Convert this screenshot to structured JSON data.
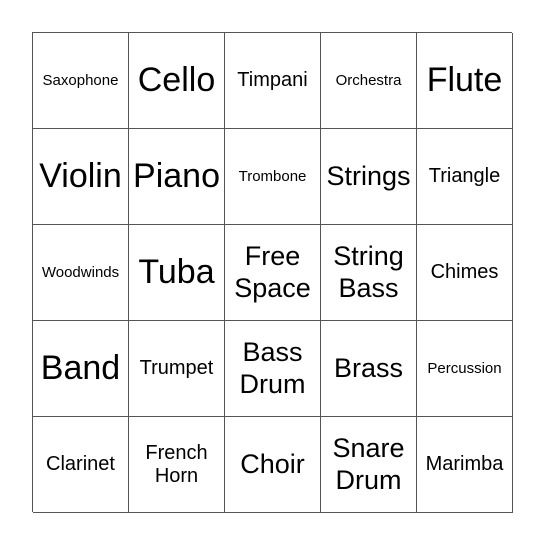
{
  "card": {
    "cells": [
      {
        "text": "Saxophone",
        "size": "s1"
      },
      {
        "text": "Cello",
        "size": "s4"
      },
      {
        "text": "Timpani",
        "size": "s2"
      },
      {
        "text": "Orchestra",
        "size": "s1"
      },
      {
        "text": "Flute",
        "size": "s4"
      },
      {
        "text": "Violin",
        "size": "s4"
      },
      {
        "text": "Piano",
        "size": "s4"
      },
      {
        "text": "Trombone",
        "size": "s1"
      },
      {
        "text": "Strings",
        "size": "s3"
      },
      {
        "text": "Triangle",
        "size": "s2"
      },
      {
        "text": "Woodwinds",
        "size": "s1"
      },
      {
        "text": "Tuba",
        "size": "s4"
      },
      {
        "text": "Free Space",
        "size": "s3"
      },
      {
        "text": "String Bass",
        "size": "s3"
      },
      {
        "text": "Chimes",
        "size": "s2"
      },
      {
        "text": "Band",
        "size": "s4"
      },
      {
        "text": "Trumpet",
        "size": "s2"
      },
      {
        "text": "Bass Drum",
        "size": "s3"
      },
      {
        "text": "Brass",
        "size": "s3"
      },
      {
        "text": "Percussion",
        "size": "s1"
      },
      {
        "text": "Clarinet",
        "size": "s2"
      },
      {
        "text": "French Horn",
        "size": "s2"
      },
      {
        "text": "Choir",
        "size": "s3"
      },
      {
        "text": "Snare Drum",
        "size": "s3"
      },
      {
        "text": "Marimba",
        "size": "s2"
      }
    ]
  }
}
